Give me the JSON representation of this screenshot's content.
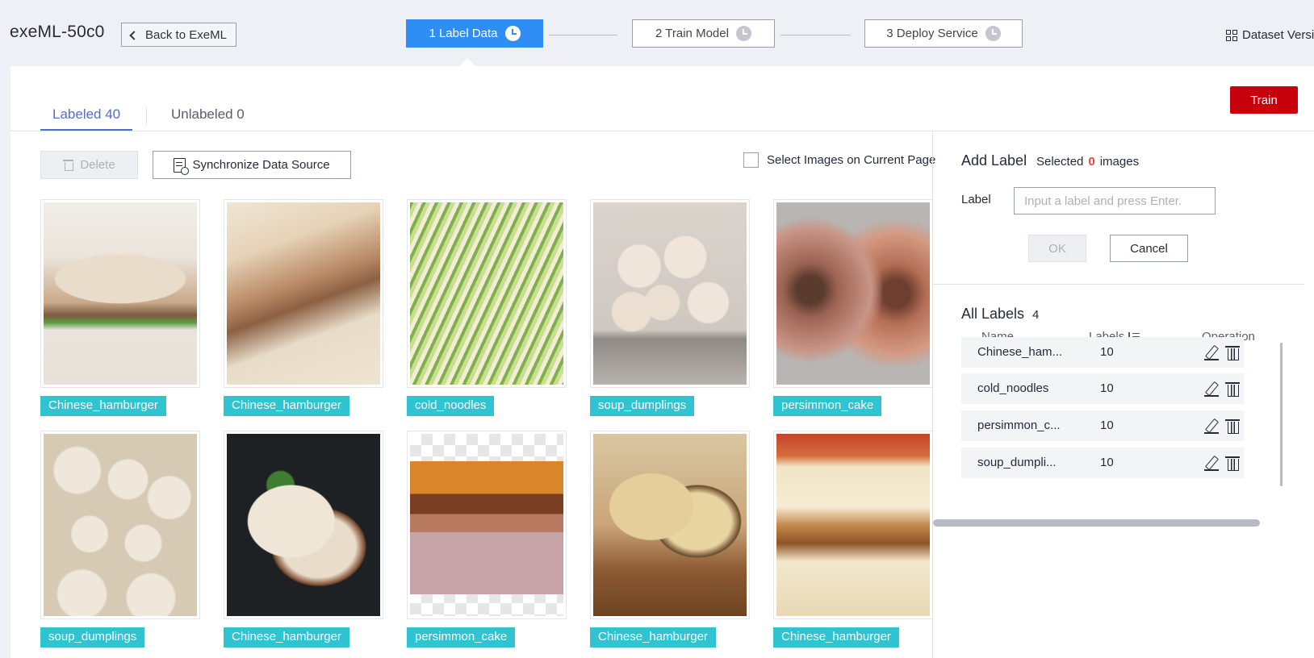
{
  "header": {
    "app_title": "exeML-50c0",
    "back_label": "Back to ExeML",
    "steps": [
      {
        "label": "1 Label Data",
        "state": "active"
      },
      {
        "label": "2 Train Model",
        "state": "pending"
      },
      {
        "label": "3 Deploy Service",
        "state": "pending"
      }
    ],
    "dataset_link": "Dataset Versi"
  },
  "tabs": {
    "labeled": "Labeled 40",
    "unlabeled": "Unlabeled 0"
  },
  "toolbar": {
    "train_label": "Train",
    "delete_label": "Delete",
    "sync_label": "Synchronize Data Source",
    "select_page_label": "Select Images on Current Page"
  },
  "images": [
    {
      "label": "Chinese_hamburger",
      "art": "img-hamburger-a"
    },
    {
      "label": "Chinese_hamburger",
      "art": "img-hamburger-b"
    },
    {
      "label": "cold_noodles",
      "art": "img-cold-noodles"
    },
    {
      "label": "soup_dumplings",
      "art": "img-soup-dumplings-a"
    },
    {
      "label": "persimmon_cake",
      "art": "img-persimmon-a"
    },
    {
      "label": "soup_dumplings",
      "art": "img-soup-dumplings-b"
    },
    {
      "label": "Chinese_hamburger",
      "art": "img-hamburger-c"
    },
    {
      "label": "persimmon_cake",
      "art": "img-persimmon-b"
    },
    {
      "label": "Chinese_hamburger",
      "art": "img-hamburger-d"
    },
    {
      "label": "Chinese_hamburger",
      "art": "img-hamburger-e"
    }
  ],
  "add_label": {
    "title": "Add Label",
    "selected_prefix": "Selected",
    "selected_count": "0",
    "selected_suffix": "images",
    "label_field": "Label",
    "placeholder": "Input a label and press Enter.",
    "value": "",
    "ok_label": "OK",
    "cancel_label": "Cancel"
  },
  "all_labels": {
    "title": "All Labels",
    "count": "4",
    "columns": {
      "name": "Name",
      "labels": "Labels",
      "operation": "Operation"
    },
    "rows": [
      {
        "name": "Chinese_ham...",
        "count": "10"
      },
      {
        "name": "cold_noodles",
        "count": "10"
      },
      {
        "name": "persimmon_c...",
        "count": "10"
      },
      {
        "name": "soup_dumpli...",
        "count": "10"
      }
    ]
  },
  "colors": {
    "accent": "#2f8ef4",
    "tab_active": "#526ecc",
    "train_button": "#c7000b",
    "label_tag": "#30c3d2",
    "selected_count": "#e54545"
  },
  "icons": [
    "chevron-left-icon",
    "clock-icon",
    "grid-icon",
    "trash-icon",
    "sync-document-icon",
    "sort-icon",
    "edit-icon",
    "delete-icon"
  ]
}
